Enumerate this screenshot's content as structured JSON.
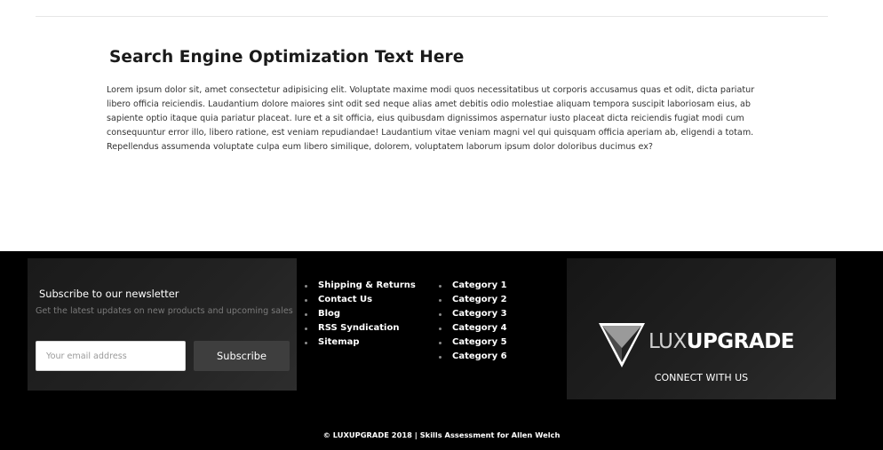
{
  "seo": {
    "title": "Search Engine Optimization Text Here",
    "body": "Lorem ipsum dolor sit, amet consectetur adipisicing elit. Voluptate maxime modi quos necessitatibus ut corporis accusamus quas et odit, dicta pariatur libero officia reiciendis. Laudantium dolore maiores sint odit sed neque alias amet debitis odio molestiae aliquam tempora suscipit laboriosam eius, ab sapiente optio itaque quia pariatur placeat. Iure et a sit officia, eius quibusdam dignissimos aspernatur iusto placeat dicta reiciendis fugiat modi cum consequuntur error illo, libero ratione, est veniam repudiandae! Laudantium vitae veniam magni vel qui quisquam officia aperiam ab, eligendi a totam. Repellendus assumenda voluptate culpa eum libero similique, dolorem, voluptatem laborum ipsum dolor doloribus ducimus ex?"
  },
  "newsletter": {
    "title": "Subscribe to our newsletter",
    "subtitle": "Get the latest updates on new products and upcoming sales",
    "email_placeholder": "Your email address",
    "button_label": "Subscribe"
  },
  "footer_links_1": [
    {
      "label": "Shipping & Returns"
    },
    {
      "label": "Contact Us"
    },
    {
      "label": "Blog"
    },
    {
      "label": "RSS Syndication"
    },
    {
      "label": "Sitemap"
    }
  ],
  "footer_links_2": [
    {
      "label": "Category 1"
    },
    {
      "label": "Category 2"
    },
    {
      "label": "Category 3"
    },
    {
      "label": "Category 4"
    },
    {
      "label": "Category 5"
    },
    {
      "label": "Category 6"
    }
  ],
  "brand": {
    "name_light": "LUX",
    "name_bold": "UPGRADE",
    "connect_label": "CONNECT WITH US",
    "logo_icon": "luxupgrade-logo-icon"
  },
  "copyright": "© LUXUPGRADE 2018 | Skills Assessment for Allen Welch",
  "colors": {
    "footer_bg": "#000000",
    "panel_bg": "#222222",
    "button_bg": "#3e3e3e",
    "text_white": "#ffffff",
    "muted_text": "#7a7a7a"
  }
}
